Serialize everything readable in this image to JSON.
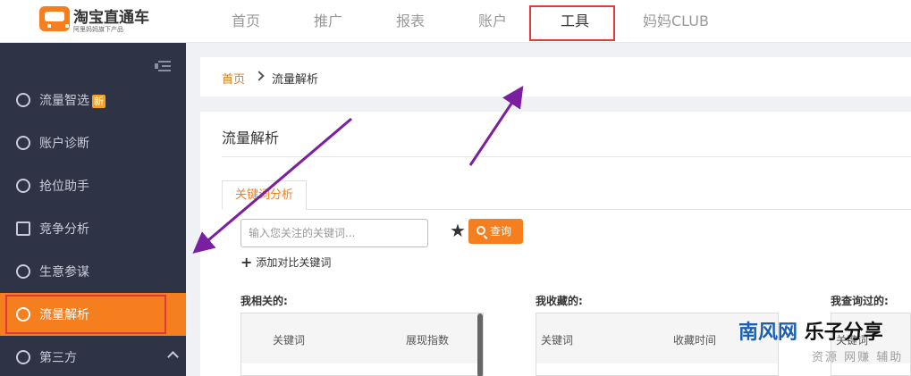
{
  "header": {
    "logo_title": "淘宝直通车",
    "logo_subtitle": "阿里妈妈旗下产品",
    "nav": [
      "首页",
      "推广",
      "报表",
      "账户",
      "工具",
      "妈妈CLUB"
    ],
    "active_nav": "工具"
  },
  "sidebar": {
    "items": [
      {
        "label": "流量智选",
        "badge": "新",
        "icon": "pulse-icon"
      },
      {
        "label": "账户诊断",
        "icon": "diagnose-icon"
      },
      {
        "label": "抢位助手",
        "icon": "target-icon"
      },
      {
        "label": "竞争分析",
        "icon": "bar-chart-icon"
      },
      {
        "label": "生意参谋",
        "icon": "compass-icon"
      },
      {
        "label": "流量解析",
        "icon": "traffic-icon",
        "active": true
      },
      {
        "label": "第三方",
        "icon": "circle-icon"
      }
    ]
  },
  "breadcrumb": {
    "home": "首页",
    "current": "流量解析"
  },
  "main": {
    "title": "流量解析",
    "tab": "关键词分析",
    "search_placeholder": "输入您关注的关键词...",
    "query_label": "查询",
    "add_compare_label": "添加对比关键词",
    "sections": [
      {
        "label": "我相关的:",
        "columns": [
          "关键词",
          "展现指数"
        ]
      },
      {
        "label": "我收藏的:",
        "columns": [
          "关键词",
          "收藏时间"
        ]
      },
      {
        "label": "我查询过的:",
        "columns": [
          "关键词"
        ]
      }
    ]
  },
  "watermark": {
    "part1": "南风网",
    "part2": "乐子分享",
    "sub": "资源 网赚 辅助"
  },
  "colors": {
    "accent": "#f57e1f",
    "sidebar_bg": "#2e3445",
    "highlight": "#e03a3a",
    "annotation_arrow": "#7b1fa2"
  }
}
